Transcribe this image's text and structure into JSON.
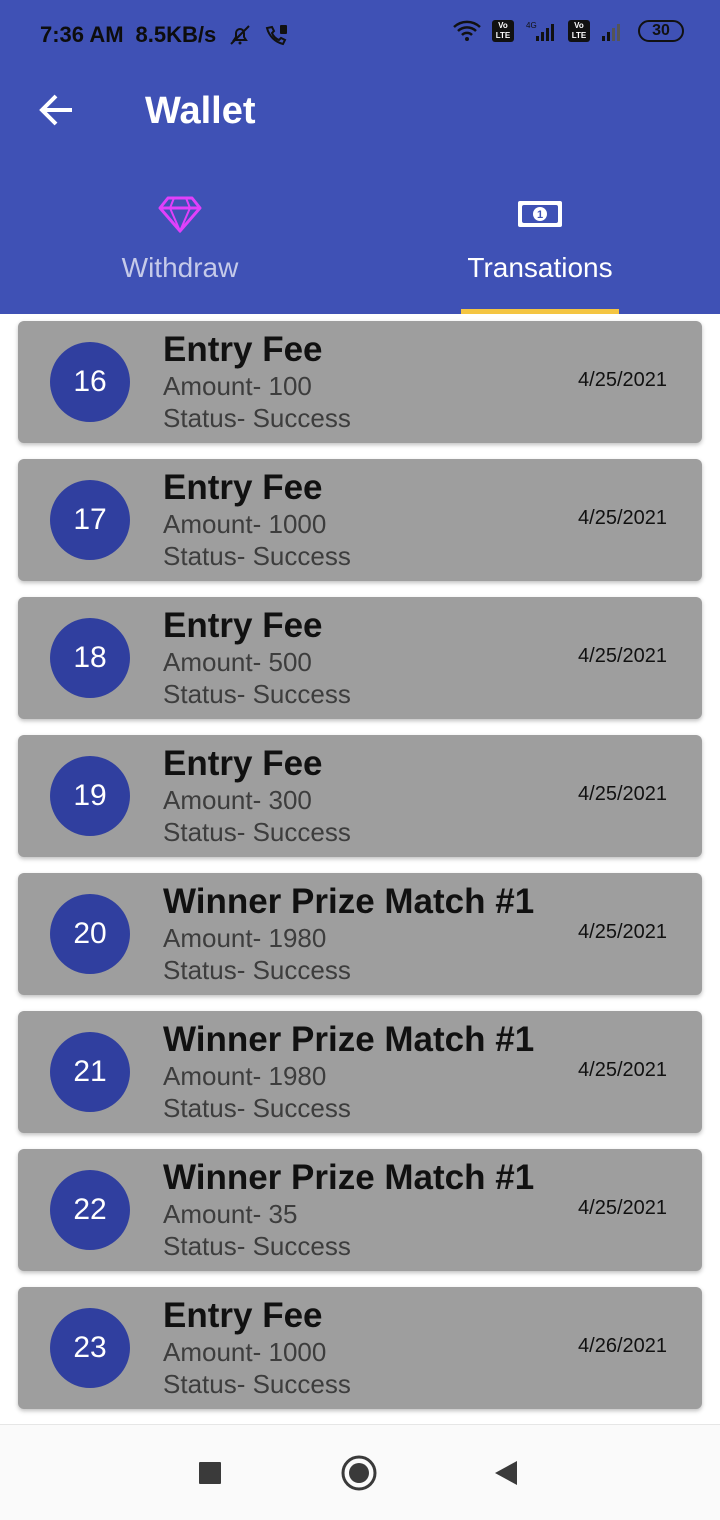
{
  "status_bar": {
    "time": "7:36 AM",
    "speed": "8.5KB/s",
    "lte1": "Vo LTE",
    "lte2": "Vo LTE",
    "network": "4G",
    "battery": "30"
  },
  "toolbar": {
    "title": "Wallet"
  },
  "tabs": [
    {
      "label": "Withdraw",
      "icon": "diamond-icon",
      "selected": false
    },
    {
      "label": "Transations",
      "icon": "cash-icon",
      "selected": true
    }
  ],
  "transactions": [
    {
      "id": "16",
      "title": "Entry Fee",
      "amount": "Amount- 100",
      "status": "Status- Success",
      "date": "4/25/2021"
    },
    {
      "id": "17",
      "title": "Entry Fee",
      "amount": "Amount- 1000",
      "status": "Status- Success",
      "date": "4/25/2021"
    },
    {
      "id": "18",
      "title": "Entry Fee",
      "amount": "Amount- 500",
      "status": "Status- Success",
      "date": "4/25/2021"
    },
    {
      "id": "19",
      "title": "Entry Fee",
      "amount": "Amount- 300",
      "status": "Status- Success",
      "date": "4/25/2021"
    },
    {
      "id": "20",
      "title": "Winner Prize Match #1",
      "amount": "Amount- 1980",
      "status": "Status- Success",
      "date": "4/25/2021"
    },
    {
      "id": "21",
      "title": "Winner Prize Match #1",
      "amount": "Amount- 1980",
      "status": "Status- Success",
      "date": "4/25/2021"
    },
    {
      "id": "22",
      "title": "Winner Prize Match #1",
      "amount": "Amount- 35",
      "status": "Status- Success",
      "date": "4/25/2021"
    },
    {
      "id": "23",
      "title": "Entry Fee",
      "amount": "Amount- 1000",
      "status": "Status- Success",
      "date": "4/26/2021"
    }
  ],
  "nav": {
    "recents": "square-icon",
    "home": "circle-icon",
    "back": "triangle-back-icon"
  },
  "colors": {
    "primary": "#3f51b5",
    "accent": "#f4c542",
    "badge": "#303f9f",
    "card": "#9e9e9e",
    "diamond": "#e040fb"
  }
}
